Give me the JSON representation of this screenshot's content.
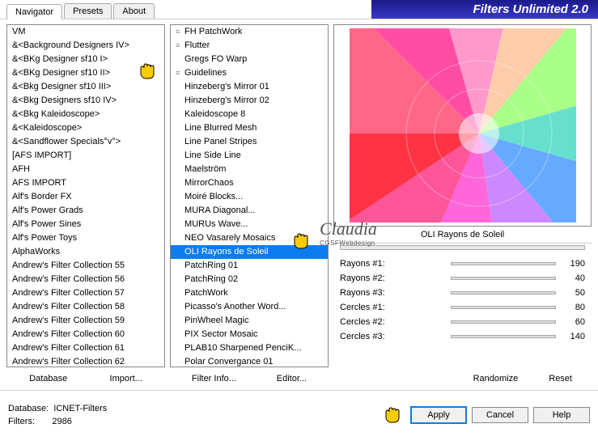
{
  "app_title": "Filters Unlimited 2.0",
  "tabs": {
    "navigator": "Navigator",
    "presets": "Presets",
    "about": "About"
  },
  "left_list": [
    "VM",
    "&<Background Designers IV>",
    "&<BKg Designer sf10 I>",
    "&<BKg Designer sf10 II>",
    "&<Bkg Designer sf10 III>",
    "&<Bkg Designers sf10 IV>",
    "&<Bkg Kaleidoscope>",
    "&<Kaleidoscope>",
    "&<Sandflower Specials°v°>",
    "[AFS IMPORT]",
    "AFH",
    "AFS IMPORT",
    "Alf's Border FX",
    "Alf's Power Grads",
    "Alf's Power Sines",
    "Alf's Power Toys",
    "AlphaWorks",
    "Andrew's Filter Collection 55",
    "Andrew's Filter Collection 56",
    "Andrew's Filter Collection 57",
    "Andrew's Filter Collection 58",
    "Andrew's Filter Collection 59",
    "Andrew's Filter Collection 60",
    "Andrew's Filter Collection 61",
    "Andrew's Filter Collection 62"
  ],
  "mid_list": [
    {
      "t": "FH PatchWork",
      "g": 1
    },
    {
      "t": "Flutter",
      "g": 1
    },
    {
      "t": "Gregs FO Warp",
      "g": 0
    },
    {
      "t": "Guidelines",
      "g": 1
    },
    {
      "t": "Hinzeberg's Mirror 01",
      "g": 0
    },
    {
      "t": "Hinzeberg's Mirror 02",
      "g": 0
    },
    {
      "t": "Kaleidoscope 8",
      "g": 0
    },
    {
      "t": "Line Blurred Mesh",
      "g": 0
    },
    {
      "t": "Line Panel Stripes",
      "g": 0
    },
    {
      "t": "Line Side Line",
      "g": 0
    },
    {
      "t": "Maelström",
      "g": 0
    },
    {
      "t": "MirrorChaos",
      "g": 0
    },
    {
      "t": "Moiré Blocks...",
      "g": 0
    },
    {
      "t": "MURA Diagonal...",
      "g": 0
    },
    {
      "t": "MURUs Wave...",
      "g": 0
    },
    {
      "t": "NEO Vasarely Mosaics",
      "g": 0
    },
    {
      "t": "OLI Rayons de Soleil",
      "g": 0,
      "sel": true
    },
    {
      "t": "PatchRing 01",
      "g": 0
    },
    {
      "t": "PatchRing 02",
      "g": 0
    },
    {
      "t": "PatchWork",
      "g": 0
    },
    {
      "t": "Picasso's Another Word...",
      "g": 0
    },
    {
      "t": "PinWheel Magic",
      "g": 0
    },
    {
      "t": "PIX Sector Mosaic",
      "g": 0
    },
    {
      "t": "PLAB10 Sharpened PenciK...",
      "g": 0
    },
    {
      "t": "Polar Convergance 01",
      "g": 0
    }
  ],
  "left_buttons": {
    "database": "Database",
    "import": "Import..."
  },
  "mid_buttons": {
    "info": "Filter Info...",
    "editor": "Editor..."
  },
  "filter_name": "OLI Rayons de Soleil",
  "params": [
    {
      "label": "Rayons #1:",
      "val": "190"
    },
    {
      "label": "Rayons #2:",
      "val": "40"
    },
    {
      "label": "Rayons #3:",
      "val": "50"
    },
    {
      "label": "Cercles #1:",
      "val": "80"
    },
    {
      "label": "Cercles #2:",
      "val": "60"
    },
    {
      "label": "Cercles #3:",
      "val": "140"
    }
  ],
  "right_buttons": {
    "randomize": "Randomize",
    "reset": "Reset"
  },
  "footer": {
    "db_label": "Database:",
    "db_val": "ICNET-Filters",
    "filters_label": "Filters:",
    "filters_val": "2986",
    "apply": "Apply",
    "cancel": "Cancel",
    "help": "Help"
  },
  "watermark": {
    "sig": "Claudia",
    "sub": "CGSFWebdesign"
  }
}
